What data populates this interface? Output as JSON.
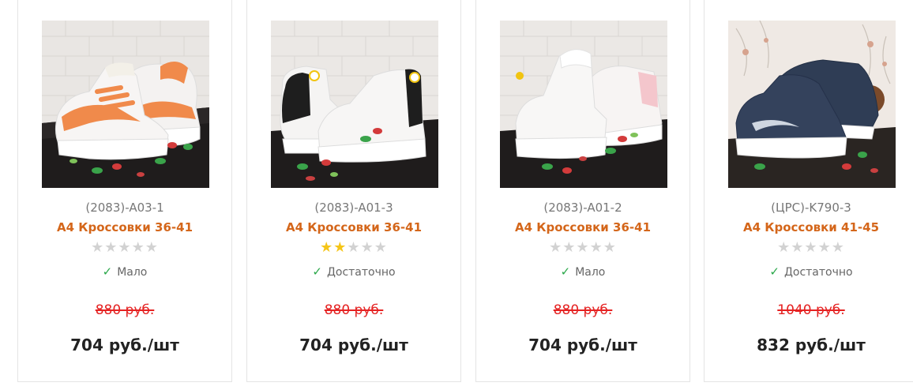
{
  "products": [
    {
      "sku": "(2083)-A03-1",
      "title": "А4 Кроссовки 36-41",
      "rating": 0,
      "stock_text": "Мало",
      "old_price": "880 руб.",
      "price": "704 руб./шт",
      "image_icon": "white-orange-high-sneakers"
    },
    {
      "sku": "(2083)-A01-3",
      "title": "А4 Кроссовки 36-41",
      "rating": 2,
      "stock_text": "Достаточно",
      "old_price": "880 руб.",
      "price": "704 руб./шт",
      "image_icon": "white-black-high-sneakers"
    },
    {
      "sku": "(2083)-A01-2",
      "title": "А4 Кроссовки 36-41",
      "rating": 0,
      "stock_text": "Мало",
      "old_price": "880 руб.",
      "price": "704 руб./шт",
      "image_icon": "white-pink-high-sneakers"
    },
    {
      "sku": "(ЦРС)-K790-3",
      "title": "А4 Кроссовки 41-45",
      "rating": 0,
      "stock_text": "Достаточно",
      "old_price": "1040 руб.",
      "price": "832 руб./шт",
      "image_icon": "navy-running-sneakers"
    }
  ],
  "rating_max": 5,
  "colors": {
    "title": "#d4661a",
    "old_price": "#e52222",
    "stock_check": "#2aa84a",
    "star_on": "#f5c518",
    "star_off": "#d2d2d2"
  }
}
